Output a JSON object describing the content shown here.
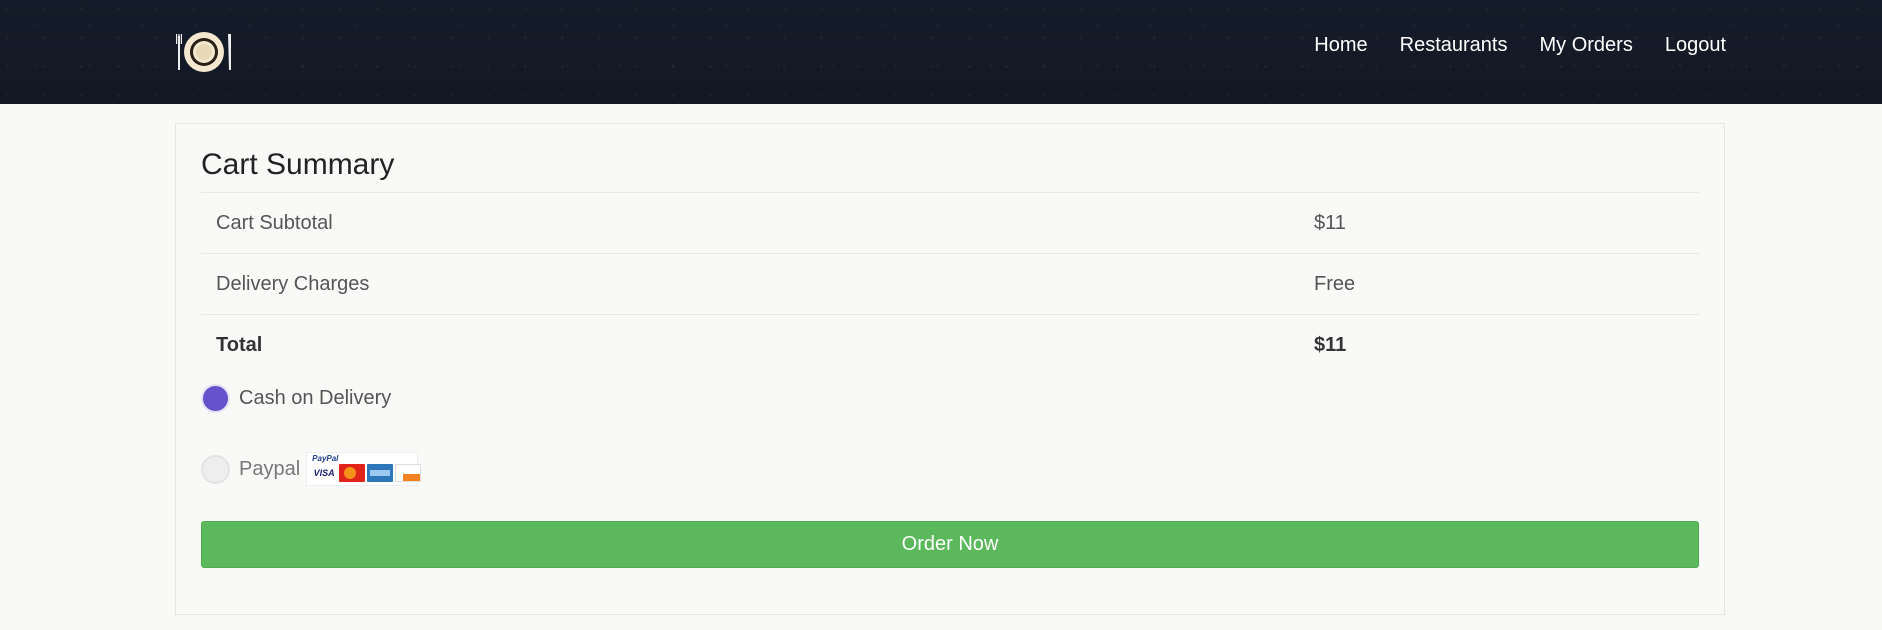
{
  "nav": {
    "links": [
      "Home",
      "Restaurants",
      "My Orders",
      "Logout"
    ]
  },
  "cart": {
    "title": "Cart Summary",
    "rows": [
      {
        "label": "Cart Subtotal",
        "value": "$11"
      },
      {
        "label": "Delivery Charges",
        "value": "Free"
      },
      {
        "label": "Total",
        "value": "$11"
      }
    ]
  },
  "payment": {
    "options": [
      {
        "label": "Cash on Delivery",
        "selected": true
      },
      {
        "label": "Paypal",
        "selected": false
      }
    ],
    "paypal_logo_text": "PayPal",
    "visa_text": "VISA"
  },
  "order_button": "Order Now",
  "colors": {
    "navbar": "#131a26",
    "accent_radio": "#6653cc",
    "button": "#5cb85c"
  },
  "icons": {
    "logo": "plate-fork-knife-icon"
  }
}
